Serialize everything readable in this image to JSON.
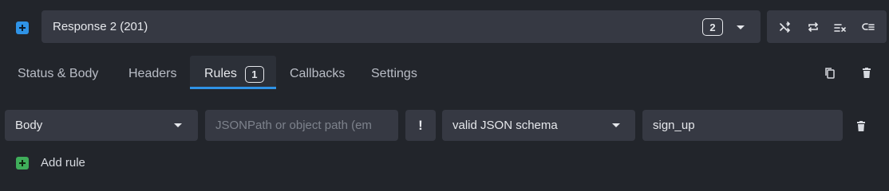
{
  "response": {
    "title": "Response 2 (201)",
    "count": "2"
  },
  "toolbar": {
    "icons": [
      "shuffle-icon",
      "repeat-icon",
      "clear-rules-icon",
      "subset-icon"
    ]
  },
  "tabs": [
    {
      "label": "Status & Body"
    },
    {
      "label": "Headers"
    },
    {
      "label": "Rules",
      "badge": "1",
      "active": true
    },
    {
      "label": "Callbacks"
    },
    {
      "label": "Settings"
    }
  ],
  "rule": {
    "target": "Body",
    "path_placeholder": "JSONPath or object path (em",
    "invert": "!",
    "operator": "valid JSON schema",
    "value": "sign_up"
  },
  "add_rule_label": "Add rule",
  "colors": {
    "accent": "#2f93e6",
    "add_green": "#3fae5a",
    "background": "#22252b",
    "field": "#363943"
  }
}
